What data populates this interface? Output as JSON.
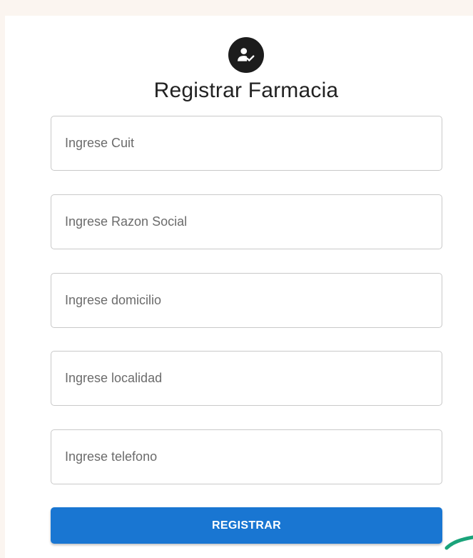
{
  "form": {
    "title": "Registrar Farmacia",
    "icon": "person-check-icon",
    "fields": [
      {
        "name": "cuit",
        "value": "",
        "placeholder": "Ingrese Cuit"
      },
      {
        "name": "razon_social",
        "value": "",
        "placeholder": "Ingrese Razon Social"
      },
      {
        "name": "domicilio",
        "value": "",
        "placeholder": "Ingrese domicilio"
      },
      {
        "name": "localidad",
        "value": "",
        "placeholder": "Ingrese localidad"
      },
      {
        "name": "telefono",
        "value": "",
        "placeholder": "Ingrese telefono"
      }
    ],
    "submit_label": "REGISTRAR"
  },
  "colors": {
    "page_background": "#fbf5f0",
    "card_background": "#ffffff",
    "avatar_background": "#1c1c1c",
    "primary_button": "#1976d2",
    "accent_swoosh": "#1aa37a"
  }
}
